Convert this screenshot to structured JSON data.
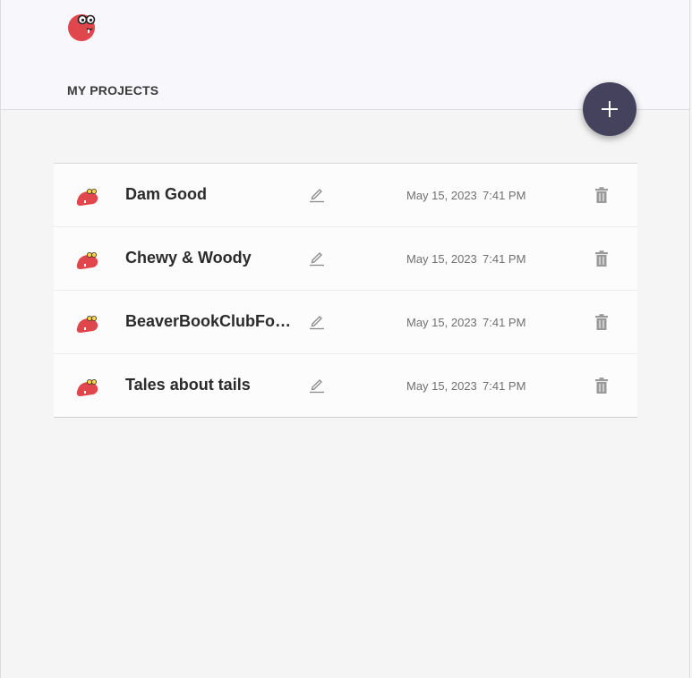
{
  "header": {
    "section_title": "MY PROJECTS",
    "logo_icon": "beaver-logo-icon",
    "add_button_icon": "plus-icon"
  },
  "colors": {
    "accent": "#45425e",
    "brand": "#e0474c",
    "header_bg": "#f8f8fc",
    "page_bg": "#f5f5f5"
  },
  "projects": [
    {
      "name": "Dam Good",
      "date": "May 15, 2023",
      "time": "7:41 PM"
    },
    {
      "name": "Chewy & Woody",
      "date": "May 15, 2023",
      "time": "7:41 PM"
    },
    {
      "name": "BeaverBookClubFo…",
      "date": "May 15, 2023",
      "time": "7:41 PM"
    },
    {
      "name": "Tales about tails",
      "date": "May 15, 2023",
      "time": "7:41 PM"
    }
  ]
}
